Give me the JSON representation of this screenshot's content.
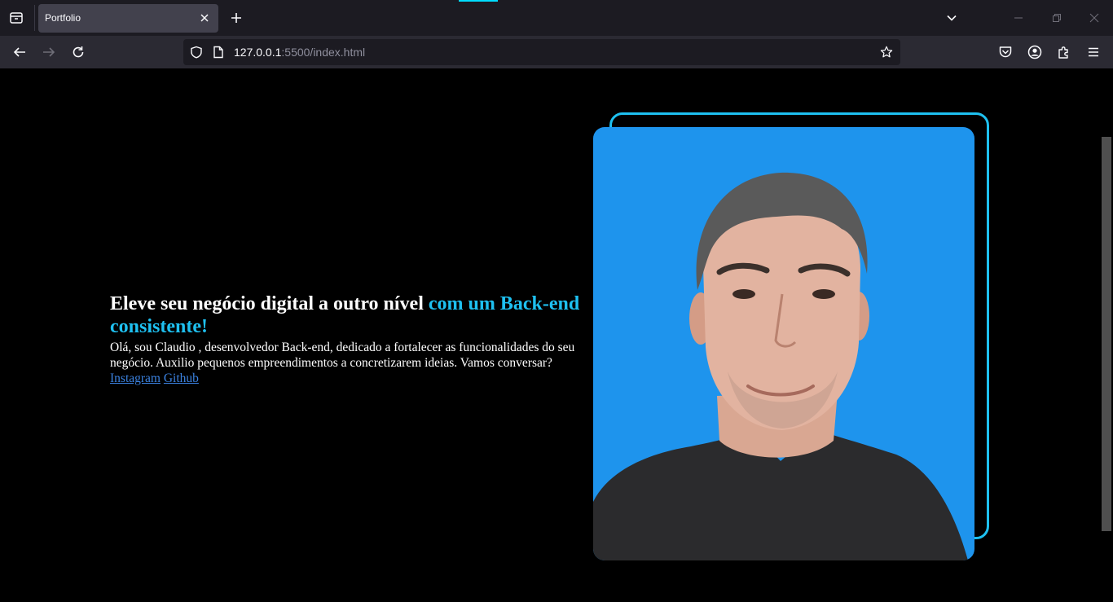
{
  "browser": {
    "tab_title": "Portfolio",
    "url_host": "127.0.0.1",
    "url_rest": ":5500/index.html"
  },
  "hero": {
    "headline_white": "Eleve seu negócio digital a outro nível ",
    "headline_accent": "com um Back-end consistente!",
    "description": "Olá, sou Claudio , desenvolvedor Back-end, dedicado a fortalecer as funcionalidades do seu negócio. Auxilio pequenos empreendimentos a concretizarem ideias. Vamos conversar?",
    "link_instagram": "Instagram",
    "link_github": "Github"
  },
  "colors": {
    "accent": "#1ec0f0",
    "photo_background": "#1e94ed",
    "page_background": "#000000",
    "link": "#3b82e0"
  },
  "icons": {
    "tab_list": "tab-list-icon",
    "close_tab": "close-icon",
    "new_tab": "plus-icon",
    "back": "arrow-left-icon",
    "forward": "arrow-right-icon",
    "reload": "reload-icon",
    "tracking_protection": "shield-icon",
    "page_info": "page-icon",
    "bookmark": "star-icon",
    "pocket": "pocket-icon",
    "account": "account-icon",
    "extensions": "puzzle-icon",
    "menu": "hamburger-icon"
  }
}
